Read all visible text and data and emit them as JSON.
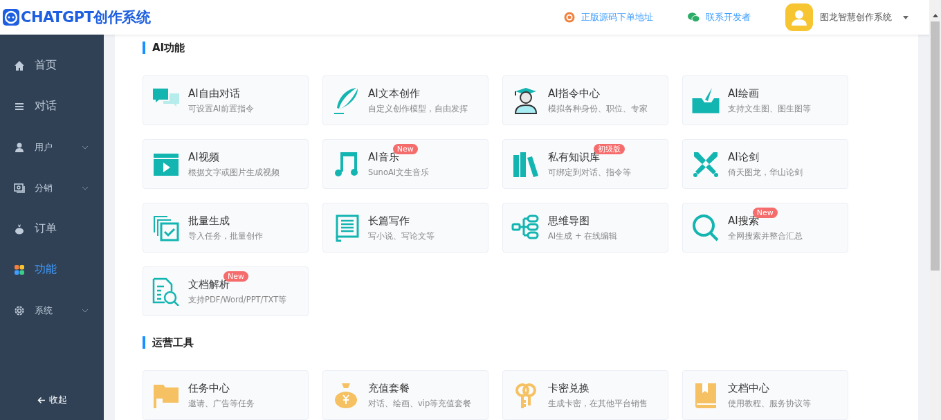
{
  "header": {
    "logo_text": "CHATGPT创作系统",
    "links": [
      {
        "label": "正版源码下单地址",
        "kind": "source"
      },
      {
        "label": "联系开发者",
        "kind": "wechat"
      }
    ],
    "user": {
      "name": "图龙智慧创作系统"
    }
  },
  "sidebar": {
    "items": [
      {
        "label": "首页",
        "selected": false,
        "has_submenu": false
      },
      {
        "label": "对话",
        "selected": false,
        "has_submenu": false
      },
      {
        "label": "用户",
        "selected": false,
        "has_submenu": true
      },
      {
        "label": "分销",
        "selected": false,
        "has_submenu": true
      },
      {
        "label": "订单",
        "selected": false,
        "has_submenu": false
      },
      {
        "label": "功能",
        "selected": true,
        "has_submenu": false
      },
      {
        "label": "系统",
        "selected": false,
        "has_submenu": true
      }
    ],
    "collapse": "收起"
  },
  "sections": [
    {
      "title": "AI功能",
      "cards": [
        {
          "title": "AI自由对话",
          "description": "可设置AI前置指令"
        },
        {
          "title": "AI文本创作",
          "description": "自定义创作模型，自由发挥"
        },
        {
          "title": "AI指令中心",
          "description": "模拟各种身份、职位、专家"
        },
        {
          "title": "AI绘画",
          "description": "支持文生图、图生图等"
        },
        {
          "title": "AI视频",
          "description": "根据文字或图片生成视频"
        },
        {
          "title": "AI音乐",
          "description": "SunoAI文生音乐",
          "badge": "New"
        },
        {
          "title": "私有知识库",
          "description": "可绑定到对话、指令等",
          "badge": "初级版"
        },
        {
          "title": "AI论剑",
          "description": "倚天图龙，华山论剑"
        },
        {
          "title": "批量生成",
          "description": "导入任务，批量创作"
        },
        {
          "title": "长篇写作",
          "description": "写小说、写论文等"
        },
        {
          "title": "思维导图",
          "description": "AI生成 + 在线编辑"
        },
        {
          "title": "AI搜索",
          "description": "全网搜索并整合汇总",
          "badge": "New"
        },
        {
          "title": "文档解析",
          "description": "支持PDF/Word/PPT/TXT等",
          "badge": "New"
        }
      ]
    },
    {
      "title": "运营工具",
      "cards": [
        {
          "title": "任务中心",
          "description": "邀请、广告等任务"
        },
        {
          "title": "充值套餐",
          "description": "对话、绘画、vip等充值套餐"
        },
        {
          "title": "卡密兑换",
          "description": "生成卡密，在其他平台销售"
        },
        {
          "title": "文档中心",
          "description": "使用教程、服务协议等"
        }
      ]
    }
  ]
}
